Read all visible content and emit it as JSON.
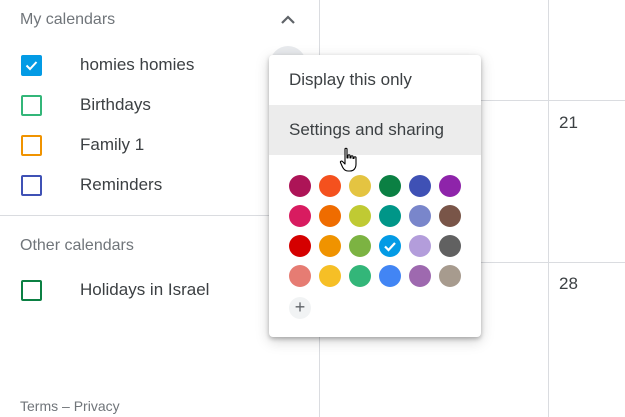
{
  "sidebar": {
    "my_calendars_title": "My calendars",
    "my_calendars": [
      {
        "label": "homies homies",
        "color": "#039be5",
        "checked": true
      },
      {
        "label": "Birthdays",
        "color": "#33b679",
        "checked": false
      },
      {
        "label": "Family 1",
        "color": "#f09300",
        "checked": false
      },
      {
        "label": "Reminders",
        "color": "#3f51b5",
        "checked": false
      }
    ],
    "other_calendars_title": "Other calendars",
    "other_calendars": [
      {
        "label": "Holidays in Israel",
        "color": "#0b8043",
        "checked": false
      }
    ],
    "footer": {
      "terms": "Terms",
      "separator": "–",
      "privacy": "Privacy"
    }
  },
  "calendar_grid": {
    "day_numbers": [
      "21",
      "28"
    ]
  },
  "context_menu": {
    "items": [
      {
        "label": "Display this only",
        "hovered": false
      },
      {
        "label": "Settings and sharing",
        "hovered": true
      }
    ],
    "palette_rows": [
      [
        "#ad1457",
        "#f4511e",
        "#e4c441",
        "#0b8043",
        "#3f51b5",
        "#8e24aa"
      ],
      [
        "#d81b60",
        "#ef6c00",
        "#c0ca33",
        "#009688",
        "#7986cb",
        "#795548"
      ],
      [
        "#d50000",
        "#f09300",
        "#7cb342",
        "#039be5",
        "#b39ddb",
        "#616161"
      ],
      [
        "#e67c73",
        "#f6bf26",
        "#33b679",
        "#4285f4",
        "#9e69af",
        "#a79b8e"
      ]
    ],
    "selected_color": "#039be5",
    "add_label": "+"
  }
}
